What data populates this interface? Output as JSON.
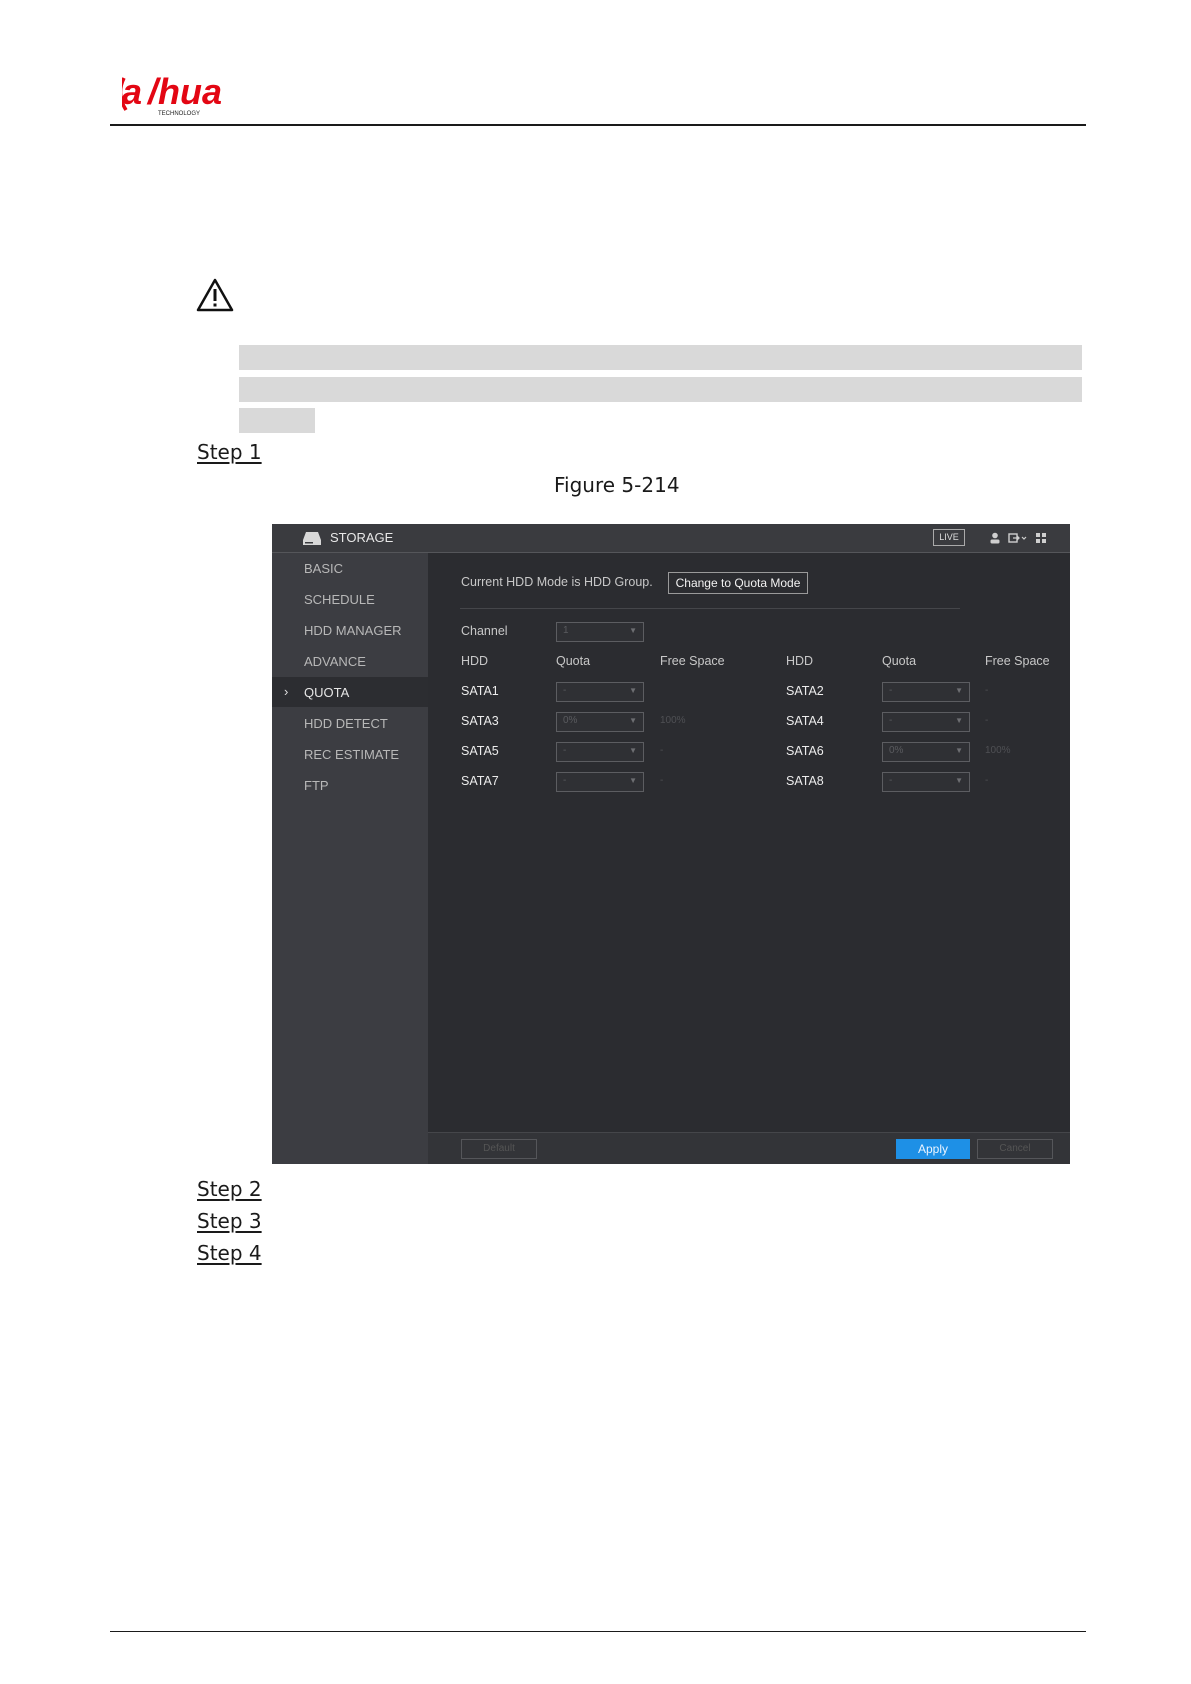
{
  "header": {
    "logo_text": "alhua",
    "logo_sub": "TECHNOLOGY"
  },
  "steps": {
    "step1": "Step 1",
    "step2": "Step 2",
    "step3": "Step 3",
    "step4": "Step 4"
  },
  "figure": {
    "caption": "Figure 5-214"
  },
  "ui": {
    "title": "STORAGE",
    "live": "LIVE",
    "sidebar": [
      "BASIC",
      "SCHEDULE",
      "HDD MANAGER",
      "ADVANCE",
      "QUOTA",
      "HDD DETECT",
      "REC ESTIMATE",
      "FTP"
    ],
    "active_item": "QUOTA",
    "mode_text": "Current HDD Mode is HDD Group.",
    "change_button": "Change to Quota Mode",
    "channel_label": "Channel",
    "channel_value": "1",
    "columns": {
      "hdd": "HDD",
      "quota": "Quota",
      "free": "Free Space"
    },
    "rows": [
      {
        "left": {
          "hdd": "SATA1",
          "quota": "-",
          "free": ""
        },
        "right": {
          "hdd": "SATA2",
          "quota": "-",
          "free": "-"
        }
      },
      {
        "left": {
          "hdd": "SATA3",
          "quota": "0%",
          "free": "100%"
        },
        "right": {
          "hdd": "SATA4",
          "quota": "-",
          "free": "-"
        }
      },
      {
        "left": {
          "hdd": "SATA5",
          "quota": "-",
          "free": "-"
        },
        "right": {
          "hdd": "SATA6",
          "quota": "0%",
          "free": "100%"
        }
      },
      {
        "left": {
          "hdd": "SATA7",
          "quota": "-",
          "free": "-"
        },
        "right": {
          "hdd": "SATA8",
          "quota": "-",
          "free": "-"
        }
      }
    ],
    "buttons": {
      "default": "Default",
      "apply": "Apply",
      "cancel": "Cancel"
    }
  }
}
